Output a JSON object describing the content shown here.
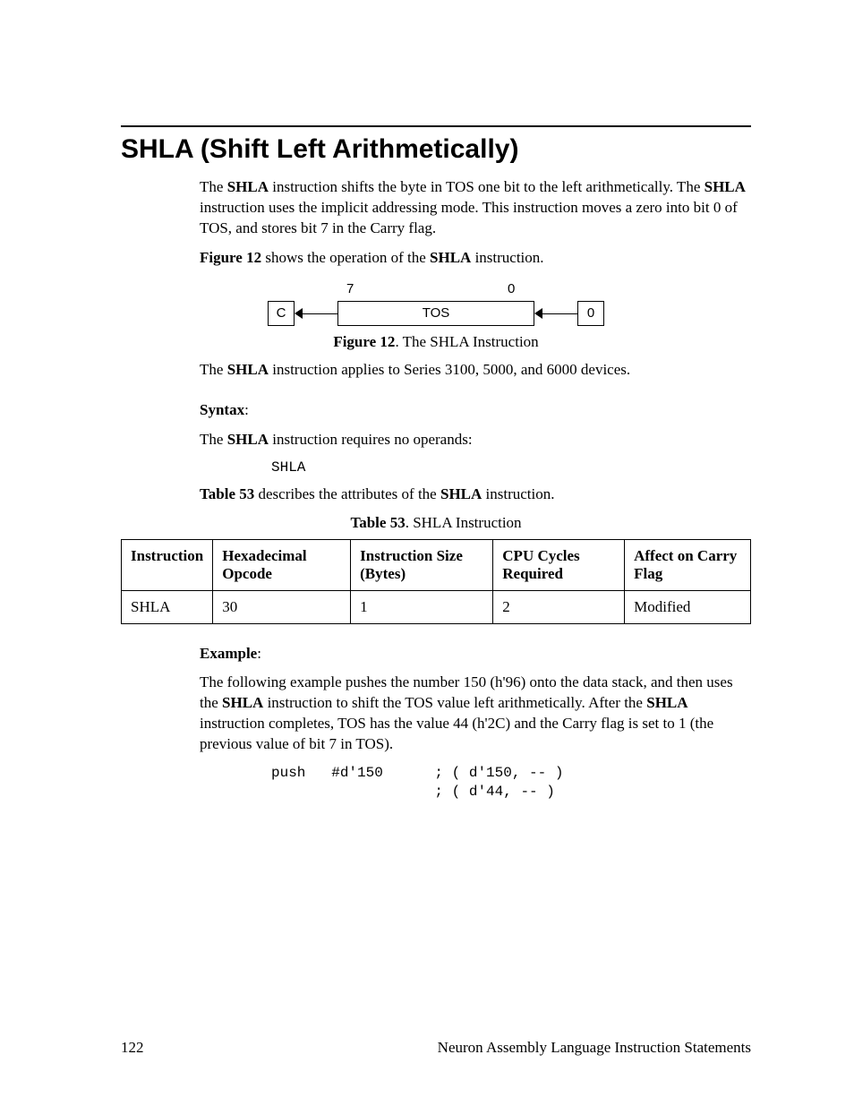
{
  "title": "SHLA (Shift Left Arithmetically)",
  "intro": {
    "p1a": "The ",
    "p1b": "SHLA",
    "p1c": " instruction shifts the byte in TOS one bit to the left arithmetically. The ",
    "p1d": "SHLA",
    "p1e": " instruction uses the implicit addressing mode.  This instruction moves a zero into bit 0 of TOS, and stores bit 7 in the Carry flag."
  },
  "fig_ref": {
    "a": "Figure 12",
    "b": " shows the operation of the ",
    "c": "SHLA",
    "d": " instruction."
  },
  "diagram": {
    "bit7": "7",
    "bit0": "0",
    "c": "C",
    "tos": "TOS",
    "zero": "0"
  },
  "fig_caption": {
    "a": "Figure 12",
    "b": ". The SHLA Instruction"
  },
  "applies": {
    "a": "The ",
    "b": "SHLA",
    "c": " instruction applies to Series 3100, 5000, and 6000 devices."
  },
  "syntax": {
    "label": "Syntax",
    "colon": ":",
    "desc_a": "The ",
    "desc_b": "SHLA",
    "desc_c": " instruction requires no operands:",
    "code": "SHLA"
  },
  "tbl_ref": {
    "a": "Table 53",
    "b": " describes the attributes of the ",
    "c": "SHLA",
    "d": " instruction."
  },
  "tbl_caption": {
    "a": "Table 53",
    "b": ". SHLA Instruction"
  },
  "table": {
    "headers": [
      "Instruction",
      "Hexadecimal Opcode",
      "Instruction Size (Bytes)",
      "CPU Cycles Required",
      "Affect on Carry Flag"
    ],
    "row": [
      "SHLA",
      "30",
      "1",
      "2",
      "Modified"
    ]
  },
  "example": {
    "label": "Example",
    "colon": ":",
    "p_a": "The following example pushes the number 150 (h'96) onto the data stack, and then uses the ",
    "p_b": "SHLA",
    "p_c": " instruction to shift the TOS value left arithmetically.  After the ",
    "p_d": "SHLA",
    "p_e": " instruction completes, TOS has the value 44 (h'2C) and the Carry flag is set to 1 (the previous value of bit 7 in TOS).",
    "code": "push   #d'150      ; ( d'150, -- )\n                   ; ( d'44, -- )"
  },
  "footer": {
    "page": "122",
    "section": "Neuron Assembly Language Instruction Statements"
  }
}
